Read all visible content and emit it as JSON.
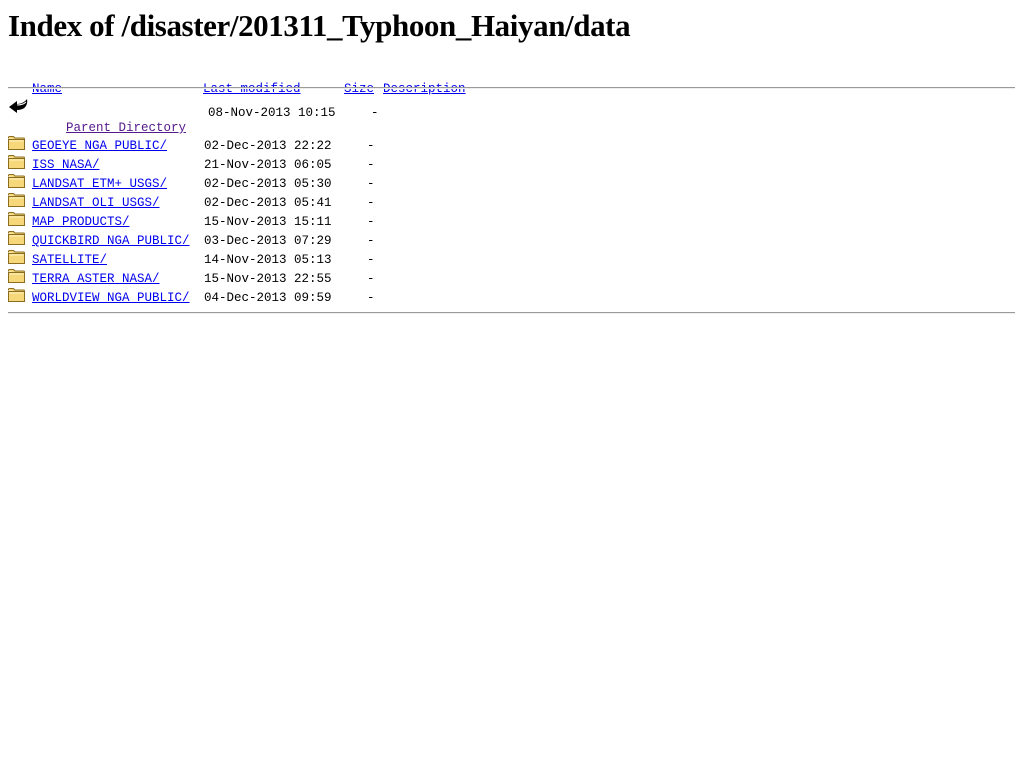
{
  "page": {
    "title": "Index of /disaster/201311_Typhoon_Haiyan/data"
  },
  "header": {
    "name": "Name",
    "last_modified": "Last modified",
    "size": "Size",
    "description": "Description"
  },
  "parent": {
    "label": "Parent Directory",
    "modified": "08-Nov-2013 10:15",
    "size": "-"
  },
  "rows": [
    {
      "name": "GEOEYE_NGA_PUBLIC/",
      "modified": "02-Dec-2013 22:22",
      "size": "-"
    },
    {
      "name": "ISS_NASA/",
      "modified": "21-Nov-2013 06:05",
      "size": "-"
    },
    {
      "name": "LANDSAT_ETM+_USGS/",
      "modified": "02-Dec-2013 05:30",
      "size": "-"
    },
    {
      "name": "LANDSAT_OLI_USGS/",
      "modified": "02-Dec-2013 05:41",
      "size": "-"
    },
    {
      "name": "MAP_PRODUCTS/",
      "modified": "15-Nov-2013 15:11",
      "size": "-"
    },
    {
      "name": "QUICKBIRD_NGA_PUBLIC/",
      "modified": "03-Dec-2013 07:29",
      "size": "-"
    },
    {
      "name": "SATELLITE/",
      "modified": "14-Nov-2013 05:13",
      "size": "-"
    },
    {
      "name": "TERRA_ASTER_NASA/",
      "modified": "15-Nov-2013 22:55",
      "size": "-"
    },
    {
      "name": "WORLDVIEW_NGA_PUBLIC/",
      "modified": "04-Dec-2013 09:59",
      "size": "-"
    }
  ],
  "icons": {
    "parent": "back-arrow-icon",
    "row": "folder-icon"
  },
  "colors": {
    "link": "#0000ee",
    "visited_link": "#551a8b",
    "folder_fill": "#f6d77a",
    "folder_stroke": "#8a6d1f"
  }
}
